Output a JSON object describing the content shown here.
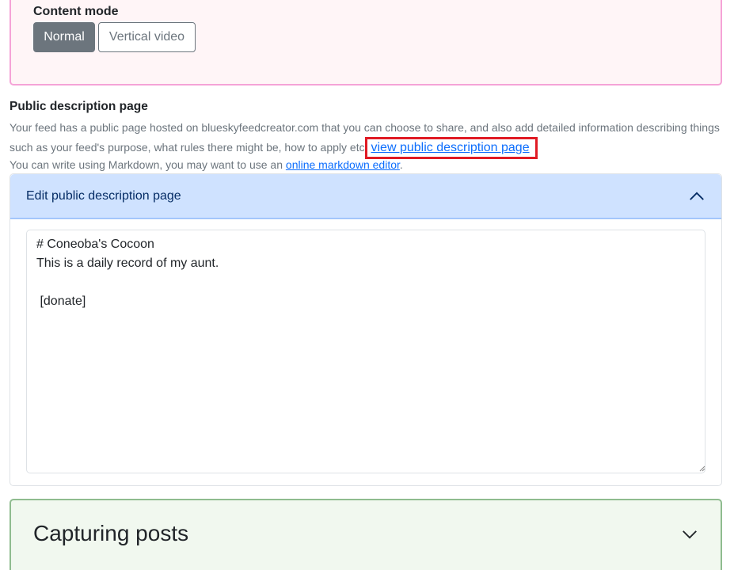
{
  "content_mode": {
    "label": "Content mode",
    "options": [
      "Normal",
      "Vertical video"
    ],
    "selected": "Normal"
  },
  "public_description": {
    "title": "Public description page",
    "description_prefix": "Your feed has a public page hosted on blueskyfeedcreator.com that you can choose to share, and also add detailed information describing things such as your feed's purpose, what rules there might be, how to apply etc",
    "view_link": "view public description page",
    "markdown_note_prefix": "You can write using Markdown, you may want to use an ",
    "markdown_link": "online markdown editor",
    "markdown_note_suffix": "."
  },
  "edit_accordion": {
    "title": "Edit public description page",
    "expanded": true,
    "textarea_value": "# Coneoba's Cocoon\nThis is a daily record of my aunt.\n\n [donate]"
  },
  "capturing": {
    "title": "Capturing posts",
    "expanded": false
  },
  "colors": {
    "primary_link": "#0d6efd",
    "highlight_border": "#e01b24",
    "content_mode_border": "#f5a3d7",
    "capturing_border": "#8fbc8f"
  }
}
